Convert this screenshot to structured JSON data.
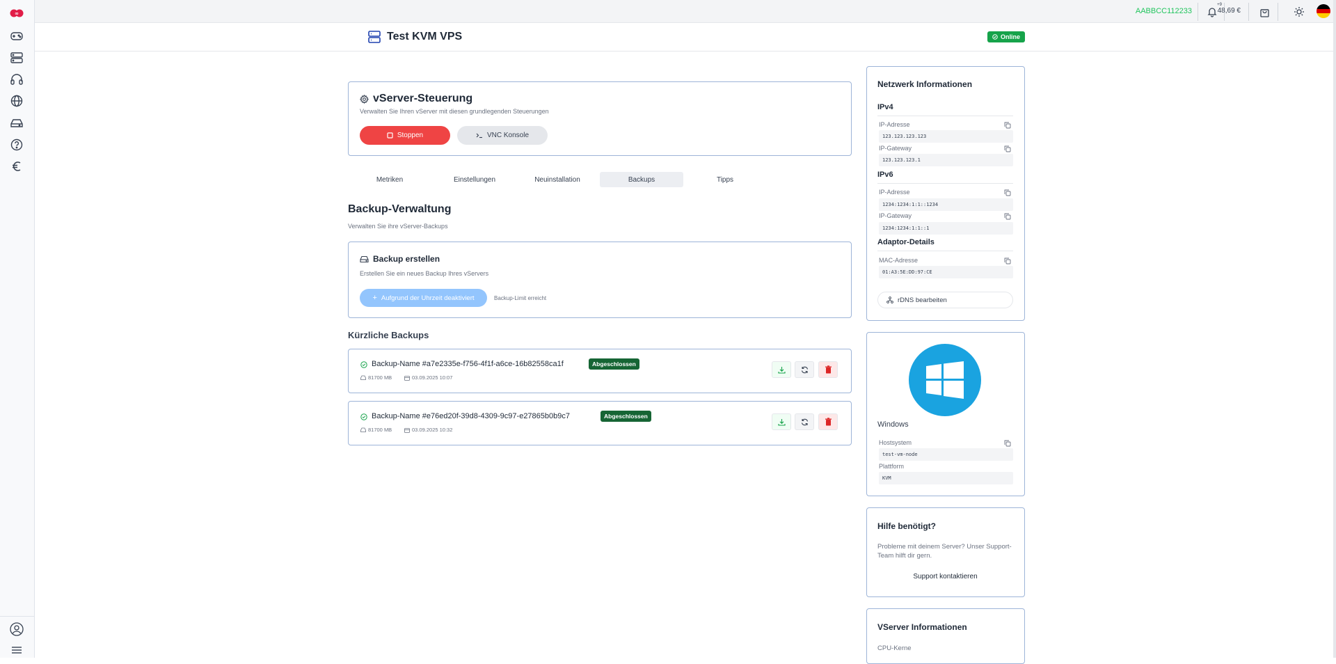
{
  "topbar": {
    "customer_code": "AABBCC112233",
    "notification_count": "+9",
    "balance": "48,69 €"
  },
  "header": {
    "title": "Test KVM VPS",
    "status": "Online"
  },
  "control": {
    "title": "vServer-Steuerung",
    "subtitle": "Verwalten Sie Ihren vServer mit diesen grundlegenden Steuerungen",
    "stop_label": "Stoppen",
    "vnc_label": "VNC Konsole"
  },
  "tabs": [
    "Metriken",
    "Einstellungen",
    "Neuinstallation",
    "Backups",
    "Tipps"
  ],
  "backup_section": {
    "title": "Backup-Verwaltung",
    "subtitle": "Verwalten Sie ihre vServer-Backups",
    "create_title": "Backup erstellen",
    "create_subtitle": "Erstellen Sie ein neues Backup Ihres vServers",
    "create_button": "Aufgrund der Uhrzeit deaktiviert",
    "limit_note": "Backup-Limit erreicht",
    "recent_title": "Kürzliche Backups"
  },
  "backups": [
    {
      "name": "Backup-Name #a7e2335e-f756-4f1f-a6ce-16b82558ca1f",
      "status": "Abgeschlossen",
      "size": "81700 MB",
      "date": "03.09.2025 10:07"
    },
    {
      "name": "Backup-Name #e76ed20f-39d8-4309-9c97-e27865b0b9c7",
      "status": "Abgeschlossen",
      "size": "81700 MB",
      "date": "03.09.2025 10:32"
    }
  ],
  "network": {
    "title": "Netzwerk Informationen",
    "ipv4_title": "IPv4",
    "ipv4_address_label": "IP-Adresse",
    "ipv4_address": "123.123.123.123",
    "ipv4_gateway_label": "IP-Gateway",
    "ipv4_gateway": "123.123.123.1",
    "ipv6_title": "IPv6",
    "ipv6_address_label": "IP-Adresse",
    "ipv6_address": "1234:1234:1:1::1234",
    "ipv6_gateway_label": "IP-Gateway",
    "ipv6_gateway": "1234:1234:1:1::1",
    "adaptor_title": "Adaptor-Details",
    "mac_label": "MAC-Adresse",
    "mac": "01:A3:5E:DD:97:CE",
    "rdns_button": "rDNS bearbeiten"
  },
  "os": {
    "name": "Windows",
    "host_label": "Hostsystem",
    "host": "test-vm-node",
    "platform_label": "Plattform",
    "platform": "KVM"
  },
  "help": {
    "title": "Hilfe benötigt?",
    "text": "Probleme mit deinem Server? Unser Support-Team hilft dir gern.",
    "button": "Support kontaktieren"
  },
  "vserver_info": {
    "title": "VServer Informationen",
    "cpu_label": "CPU-Kerne"
  },
  "colors": {
    "accent_red": "#ef4444",
    "success_green": "#16a34a",
    "badge_green": "#166534",
    "windows_blue": "#1aa3e0"
  }
}
